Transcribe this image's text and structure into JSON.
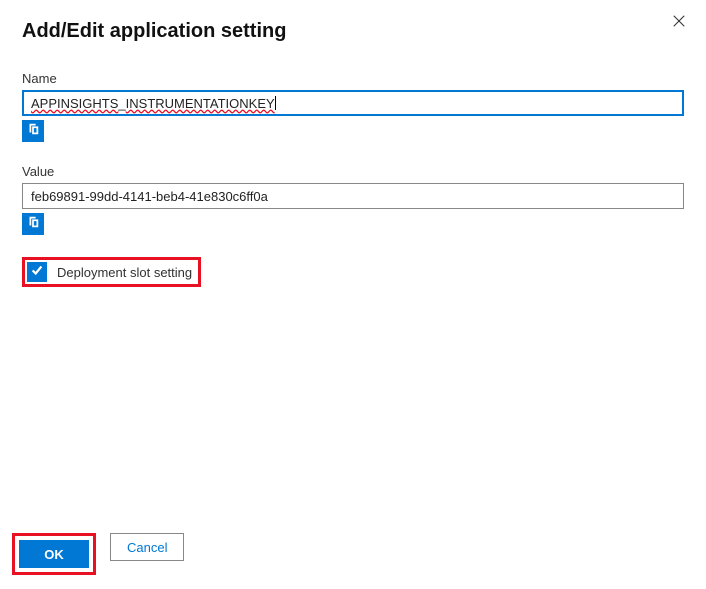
{
  "header": {
    "title": "Add/Edit application setting"
  },
  "fields": {
    "name": {
      "label": "Name",
      "value_part1": "APPINSIGHTS",
      "value_sep": "_",
      "value_part2": "INSTRUMENTATIONKEY"
    },
    "value": {
      "label": "Value",
      "value": "feb69891-99dd-4141-beb4-41e830c6ff0a"
    }
  },
  "checkbox": {
    "label": "Deployment slot setting",
    "checked": true
  },
  "buttons": {
    "ok": "OK",
    "cancel": "Cancel"
  },
  "icons": {
    "close": "close-icon",
    "copy": "copy-icon",
    "check": "check-icon"
  }
}
